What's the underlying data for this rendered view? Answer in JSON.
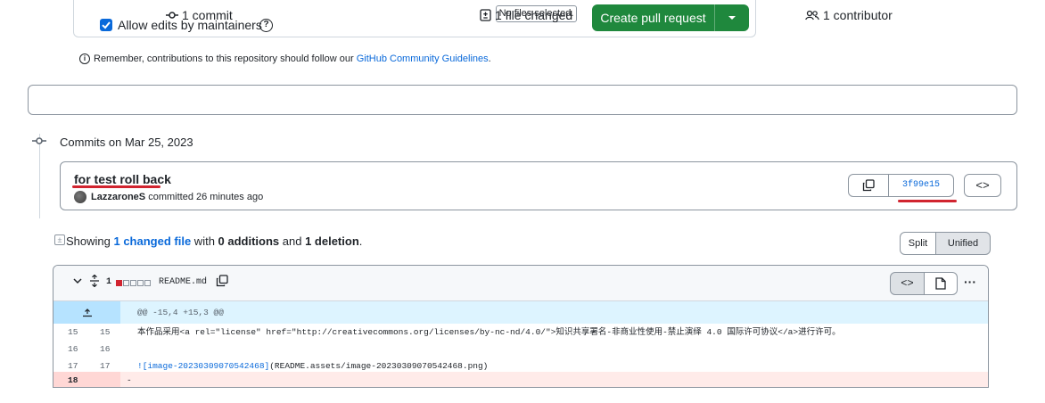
{
  "form": {
    "allow_edits_label": "Allow edits by maintainers",
    "no_files_label": "No files selected.",
    "create_pr_label": "Create pull request"
  },
  "reminder": {
    "text": "Remember, contributions to this repository should follow our",
    "link": "GitHub Community Guidelines",
    "suffix": "."
  },
  "summary": {
    "commits": "1 commit",
    "files_changed": "1 file changed",
    "contributors": "1 contributor"
  },
  "timeline": {
    "date_label": "Commits on Mar 25, 2023"
  },
  "commit": {
    "title": "for test roll back",
    "author": "LazzaroneS",
    "meta": "committed 26 minutes ago",
    "sha": "3f99e15",
    "browse_label": "<>"
  },
  "showing": {
    "prefix": "Showing ",
    "changed": "1 changed file",
    "mid": " with ",
    "additions": "0 additions",
    "and": " and ",
    "deletions": "1 deletion",
    "suffix": "."
  },
  "view": {
    "split_label": "Split",
    "unified_label": "Unified"
  },
  "file": {
    "change_count": "1",
    "name": "README.md",
    "hunk": "@@ -15,4 +15,3 @@",
    "lines": [
      {
        "old": "15",
        "new": "15",
        "text": "本作品采用<a rel=\"license\" href=\"http://creativecommons.org/licenses/by-nc-nd/4.0/\">知识共享署名-非商业性使用-禁止演绎 4.0 国际许可协议</a>进行许可。"
      },
      {
        "old": "16",
        "new": "16",
        "text": ""
      },
      {
        "old": "17",
        "new": "17",
        "text_link": "![image-20230309070542468]",
        "text_rest": "(README.assets/image-20230309070542468.png)"
      },
      {
        "old": "18",
        "new": "",
        "text": "-"
      }
    ]
  },
  "colors": {
    "accent": "#0969da",
    "primary_button": "#1f883d",
    "annotation_red": "#d1242f",
    "deletion_bg": "#ffebe9",
    "hunk_bg": "#ddf4ff"
  }
}
